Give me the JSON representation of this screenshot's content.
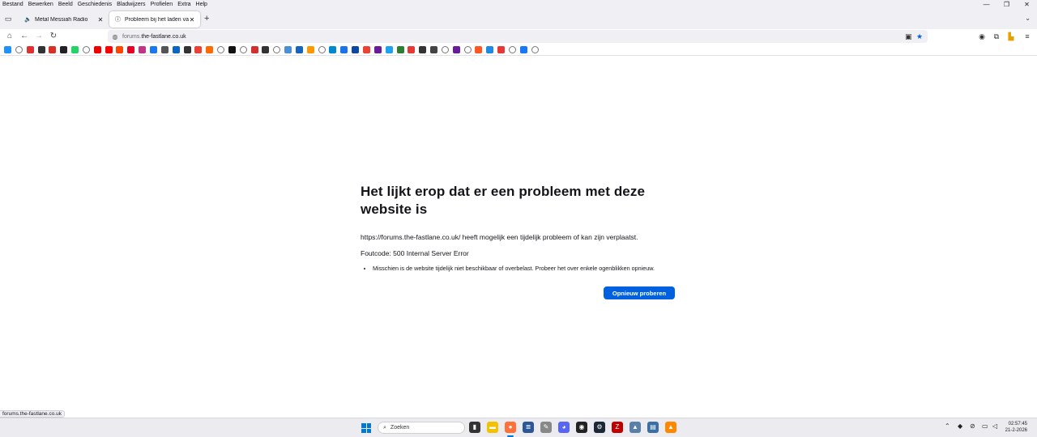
{
  "menu": [
    "Bestand",
    "Bewerken",
    "Beeld",
    "Geschiedenis",
    "Bladwijzers",
    "Profielen",
    "Extra",
    "Help"
  ],
  "window_controls": {
    "minimize": "—",
    "restore": "❐",
    "close": "✕"
  },
  "tabs": [
    {
      "label": "Metal Messiah Radio",
      "icon": "speaker-icon",
      "glyph": "🔈",
      "close": "✕"
    },
    {
      "label": "Probleem bij het laden van de pagina",
      "icon": "warning-icon",
      "glyph": "ⓘ",
      "close": "✕"
    }
  ],
  "new_tab": "+",
  "tab_list": "⌄",
  "url": {
    "domain_prefix": "forums.",
    "domain": "the-fastlane.co.uk"
  },
  "bookmarks_colors": [
    "#1e90ff",
    "#888",
    "#e03030",
    "#333",
    "#d93025",
    "#222",
    "#25d366",
    "#888",
    "#e00",
    "#ff0000",
    "#ff4500",
    "#e60023",
    "#c13584",
    "#1877f2",
    "#555",
    "#0a66c2",
    "#333",
    "#ea4335",
    "#ff6a00",
    "#888",
    "#111",
    "#888",
    "#d32f2f",
    "#333",
    "#888",
    "#4a90d9",
    "#1565c0",
    "#ff9800",
    "#888",
    "#0088cc",
    "#1a73e8",
    "#0d47a1",
    "#ea4335",
    "#6a1b9a",
    "#1da1f2",
    "#2e7d32",
    "#e53935",
    "#333",
    "#444",
    "#888",
    "#6a1b9a",
    "#888",
    "#ff5722",
    "#1e88e5",
    "#e53935",
    "#888",
    "#1877f2",
    "#888"
  ],
  "error": {
    "title": "Het lijkt erop dat er een probleem met deze website is",
    "description": "https://forums.the-fastlane.co.uk/ heeft mogelijk een tijdelijk probleem of kan zijn verplaatst.",
    "code": "Foutcode: 500 Internal Server Error",
    "hints": [
      "Misschien is de website tijdelijk niet beschikbaar of overbelast. Probeer het over enkele ogenblikken opnieuw."
    ],
    "retry_label": "Opnieuw proberen"
  },
  "status_link": "forums.the-fastlane.co.uk",
  "taskbar": {
    "search_placeholder": "Zoeken",
    "clock_time": "02:57:45",
    "clock_date": "21-2-2026"
  }
}
